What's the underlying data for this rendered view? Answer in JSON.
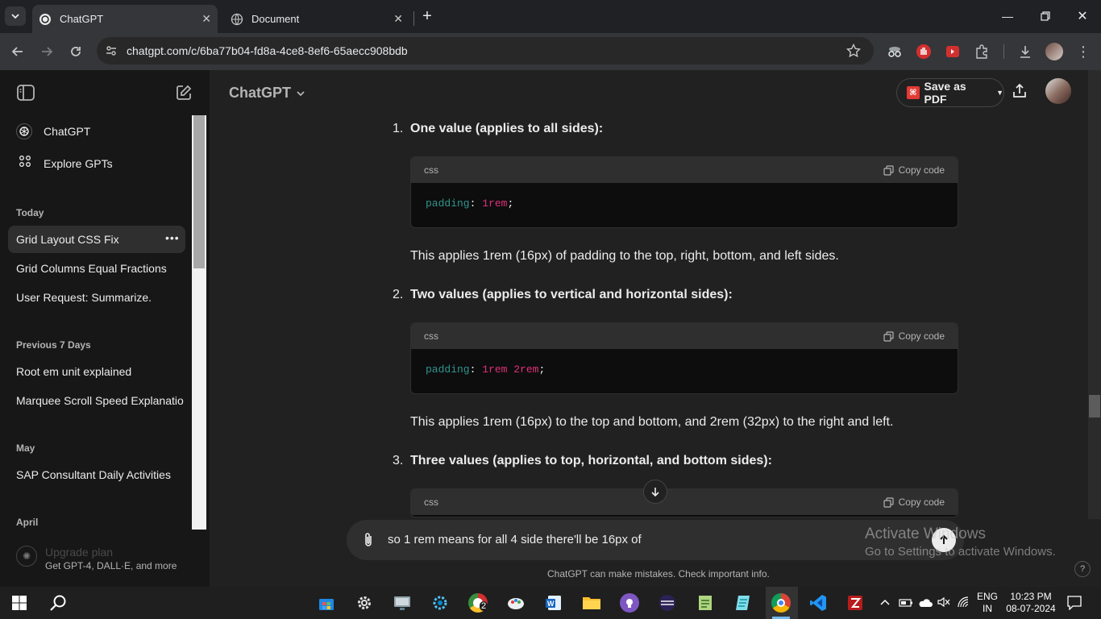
{
  "browser": {
    "tabs": [
      {
        "title": "ChatGPT",
        "active": true
      },
      {
        "title": "Document",
        "active": false
      }
    ],
    "url": "chatgpt.com/c/6ba77b04-fd8a-4ce8-8ef6-65aecc908bdb"
  },
  "sidebar": {
    "top_items": [
      "ChatGPT",
      "Explore GPTs"
    ],
    "sections": [
      {
        "label": "Today",
        "items": [
          "Grid Layout CSS Fix",
          "Grid Columns Equal Fractions",
          "User Request: Summarize."
        ]
      },
      {
        "label": "Previous 7 Days",
        "items": [
          "Root em unit explained",
          "Marquee Scroll Speed Explanatio"
        ]
      },
      {
        "label": "May",
        "items": [
          "SAP Consultant Daily Activities"
        ]
      },
      {
        "label": "April",
        "items": []
      }
    ],
    "upgrade": {
      "title": "Upgrade plan",
      "subtitle": "Get GPT-4, DALL·E, and more"
    }
  },
  "header": {
    "model": "ChatGPT",
    "save_pdf": "Save as PDF"
  },
  "content": {
    "items": [
      {
        "num": "1.",
        "heading": "One value (applies to all sides):",
        "code_lang": "css",
        "copy": "Copy code",
        "code_prop": "padding",
        "code_val": "1rem",
        "para": "This applies 1rem (16px) of padding to the top, right, bottom, and left sides."
      },
      {
        "num": "2.",
        "heading": "Two values (applies to vertical and horizontal sides):",
        "code_lang": "css",
        "copy": "Copy code",
        "code_prop": "padding",
        "code_val": "1rem 2rem",
        "para": "This applies 1rem (16px) to the top and bottom, and 2rem (32px) to the right and left."
      },
      {
        "num": "3.",
        "heading": "Three values (applies to top, horizontal, and bottom sides):",
        "code_lang": "css",
        "copy": "Copy code"
      }
    ]
  },
  "composer": {
    "text": "so 1 rem means for all 4 side there'll be 16px of"
  },
  "footer": {
    "disclaimer": "ChatGPT can make mistakes. Check important info.",
    "help": "?"
  },
  "watermark": {
    "title": "Activate Windows",
    "subtitle": "Go to Settings to activate Windows."
  },
  "taskbar": {
    "lang_top": "ENG",
    "lang_bottom": "IN",
    "time": "10:23 PM",
    "date": "08-07-2024",
    "badge": "2"
  }
}
